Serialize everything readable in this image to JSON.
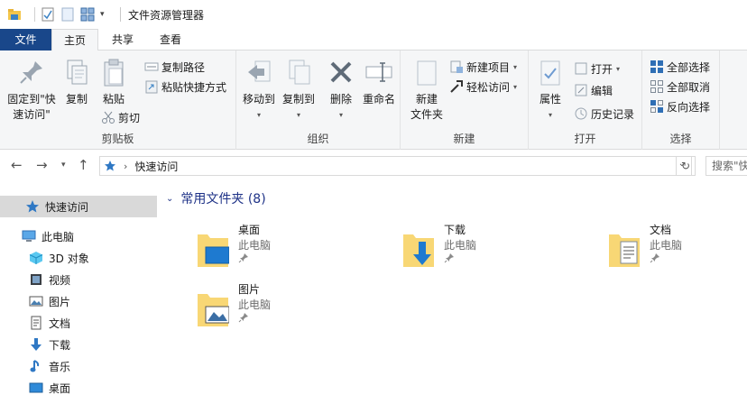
{
  "window": {
    "title": "文件资源管理器"
  },
  "tabs": {
    "file": "文件",
    "home": "主页",
    "share": "共享",
    "view": "查看"
  },
  "ribbon": {
    "clipboard": {
      "label": "剪贴板",
      "pin": "固定到\"快速访问\"",
      "pin_line1": "固定到\"快",
      "pin_line2": "速访问\"",
      "copy": "复制",
      "paste": "粘贴",
      "copy_path": "复制路径",
      "paste_shortcut": "粘贴快捷方式",
      "cut": "剪切"
    },
    "organize": {
      "label": "组织",
      "move_to": "移动到",
      "copy_to": "复制到",
      "delete": "删除",
      "rename": "重命名"
    },
    "new": {
      "label": "新建",
      "new_folder_line1": "新建",
      "new_folder_line2": "文件夹",
      "new_item": "新建项目",
      "easy_access": "轻松访问"
    },
    "open": {
      "label": "打开",
      "properties": "属性",
      "open": "打开",
      "edit": "编辑",
      "history": "历史记录"
    },
    "select": {
      "label": "选择",
      "select_all": "全部选择",
      "select_none": "全部取消",
      "invert": "反向选择"
    }
  },
  "address": {
    "path": "快速访问",
    "search_placeholder": "搜索\"快"
  },
  "nav": {
    "items": [
      {
        "label": "快速访问",
        "icon": "star-icon"
      },
      {
        "label": "此电脑",
        "icon": "computer-icon"
      },
      {
        "label": "3D 对象",
        "icon": "cube-icon"
      },
      {
        "label": "视频",
        "icon": "video-icon"
      },
      {
        "label": "图片",
        "icon": "picture-icon"
      },
      {
        "label": "文档",
        "icon": "document-icon"
      },
      {
        "label": "下载",
        "icon": "download-icon"
      },
      {
        "label": "音乐",
        "icon": "music-icon"
      },
      {
        "label": "桌面",
        "icon": "desktop-icon"
      }
    ]
  },
  "content": {
    "section_title": "常用文件夹 (8)",
    "folders": [
      {
        "name": "桌面",
        "location": "此电脑",
        "icon": "desktop-folder-icon"
      },
      {
        "name": "下载",
        "location": "此电脑",
        "icon": "download-folder-icon"
      },
      {
        "name": "文档",
        "location": "此电脑",
        "icon": "document-folder-icon"
      },
      {
        "name": "图片",
        "location": "此电脑",
        "icon": "picture-folder-icon"
      }
    ]
  },
  "colors": {
    "file_tab": "#19478a",
    "accent": "#1e3287",
    "folder_yellow": "#f8d775",
    "selection": "#d9d9d9"
  }
}
